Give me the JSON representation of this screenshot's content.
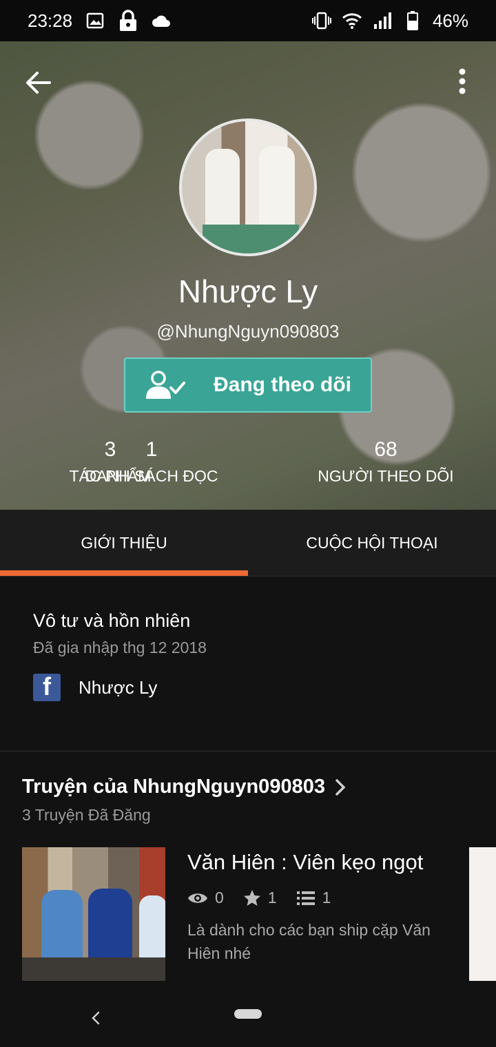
{
  "status_bar": {
    "time": "23:28",
    "battery": "46%",
    "left_icons": [
      "image-icon",
      "lock-icon",
      "cloud-icon"
    ],
    "right_icons": [
      "vibrate-icon",
      "wifi-icon",
      "signal-icon",
      "battery-icon"
    ]
  },
  "profile": {
    "name": "Nhược Ly",
    "handle": "@NhungNguyn090803",
    "follow_label": "Đang theo dõi",
    "stats": [
      {
        "value": "3",
        "label": "TÁC PHẨM"
      },
      {
        "value": "1",
        "label": "DANH SÁCH ĐỌC"
      },
      {
        "value": "68",
        "label": "NGƯỜI THEO DÕI"
      }
    ]
  },
  "tabs": [
    {
      "label": "GIỚI THIỆU",
      "active": true
    },
    {
      "label": "CUỘC HỘI THOẠI",
      "active": false
    }
  ],
  "about": {
    "bio": "Vô tư và hồn nhiên",
    "joined": "Đã gia nhập thg 12 2018",
    "facebook_name": "Nhược Ly"
  },
  "stories": {
    "title": "Truyện của NhungNguyn090803",
    "count_text": "3 Truyện Đã Đăng",
    "items": [
      {
        "title": "Văn Hiên : Viên kẹo ngọt",
        "views": "0",
        "votes": "1",
        "parts": "1",
        "description": "Là dành cho các bạn ship cặp Văn Hiên nhé"
      }
    ]
  },
  "colors": {
    "accent": "#ee6a34",
    "follow_button": "#3aa596",
    "background": "#121212",
    "facebook": "#3b5998"
  }
}
